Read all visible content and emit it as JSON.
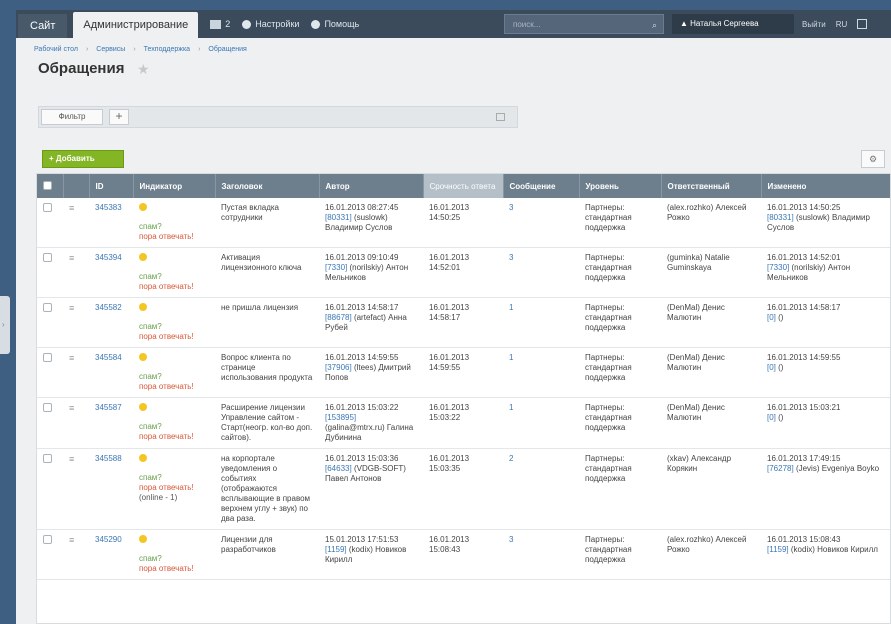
{
  "topbar": {
    "site_tab": "Сайт",
    "admin_tab": "Администрирование",
    "notifications_count": "2",
    "settings_label": "Настройки",
    "help_label": "Помощь",
    "search_placeholder": "поиск...",
    "user_name": "Наталья Сергеева",
    "logout_label": "Выйти",
    "lang_label": "RU"
  },
  "breadcrumb": [
    "Рабочий стол",
    "Сервисы",
    "Техподдержка",
    "Обращения"
  ],
  "page": {
    "title": "Обращения"
  },
  "filter": {
    "button_label": "Фильтр",
    "add_symbol": "+"
  },
  "toolbar": {
    "add_label": "Добавить"
  },
  "table": {
    "columns": [
      "ID",
      "Индикатор",
      "Заголовок",
      "Автор",
      "Срочность ответа",
      "Сообщение",
      "Уровень",
      "Ответственный",
      "Изменено"
    ],
    "spam_label": "спам?",
    "answer_label": "пора отвечать!",
    "rows": [
      {
        "id": "345383",
        "extra": "",
        "title": "Пустая вкладка сотрудники",
        "author_date": "16.01.2013 08:27:45",
        "author_link": "[80331]",
        "author_name": "(suslowk) Владимир Суслов",
        "urgency": "16.01.2013 14:50:25",
        "messages": "3",
        "level": "Партнеры: стандартная поддержка",
        "responsible": "(alex.rozhko) Алексей Рожко",
        "changed": "16.01.2013 14:50:25",
        "changed_link": "[80331]",
        "changed_name": "(suslowk) Владимир Суслов"
      },
      {
        "id": "345394",
        "extra": "",
        "title": "Активация лицензионного ключа",
        "author_date": "16.01.2013 09:10:49",
        "author_link": "[7330]",
        "author_name": "(norilskiy) Антон Мельников",
        "urgency": "16.01.2013 14:52:01",
        "messages": "3",
        "level": "Партнеры: стандартная поддержка",
        "responsible": "(guminka) Natalie Guminskaya",
        "changed": "16.01.2013 14:52:01",
        "changed_link": "[7330]",
        "changed_name": "(norilskiy) Антон Мельников"
      },
      {
        "id": "345582",
        "extra": "",
        "title": "не пришла лицензия",
        "author_date": "16.01.2013 14:58:17",
        "author_link": "[88678]",
        "author_name": "(artefact) Анна Рубей",
        "urgency": "16.01.2013 14:58:17",
        "messages": "1",
        "level": "Партнеры: стандартная поддержка",
        "responsible": "(DenMal) Денис Малютин",
        "changed": "16.01.2013 14:58:17",
        "changed_link": "[0]",
        "changed_name": "()"
      },
      {
        "id": "345584",
        "extra": "",
        "title": "Вопрос клиента по странице использования продукта",
        "author_date": "16.01.2013 14:59:55",
        "author_link": "[37906]",
        "author_name": "(ltees) Дмитрий Попов",
        "urgency": "16.01.2013 14:59:55",
        "messages": "1",
        "level": "Партнеры: стандартная поддержка",
        "responsible": "(DenMal) Денис Малютин",
        "changed": "16.01.2013 14:59:55",
        "changed_link": "[0]",
        "changed_name": "()"
      },
      {
        "id": "345587",
        "extra": "",
        "title": "Расширение лицензии Управление сайтом - Старт(неогр. кол-во доп. сайтов).",
        "author_date": "16.01.2013 15:03:22",
        "author_link": "[153895]",
        "author_name": "(galina@mtrx.ru) Галина Дубинина",
        "urgency": "16.01.2013 15:03:22",
        "messages": "1",
        "level": "Партнеры: стандартная поддержка",
        "responsible": "(DenMal) Денис Малютин",
        "changed": "16.01.2013 15:03:21",
        "changed_link": "[0]",
        "changed_name": "()"
      },
      {
        "id": "345588",
        "extra": "(online - 1)",
        "title": "на корпортале уведомления о событиях (отображаются всплывающие в правом верхнем углу + звук) по два раза.",
        "author_date": "16.01.2013 15:03:36",
        "author_link": "[64633]",
        "author_name": "(VDGB-SOFT) Павел Антонов",
        "urgency": "16.01.2013 15:03:35",
        "messages": "2",
        "level": "Партнеры: стандартная поддержка",
        "responsible": "(xkav) Александр Корякин",
        "changed": "16.01.2013 17:49:15",
        "changed_link": "[76278]",
        "changed_name": "(Jevis) Evgeniya Boyko"
      },
      {
        "id": "345290",
        "extra": "",
        "title": "Лицензии для разработчиков",
        "author_date": "15.01.2013 17:51:53",
        "author_link": "[1159]",
        "author_name": "(kodix) Новиков Кирилл",
        "urgency": "16.01.2013 15:08:43",
        "messages": "3",
        "level": "Партнеры: стандартная поддержка",
        "responsible": "(alex.rozhko) Алексей Рожко",
        "changed": "16.01.2013 15:08:43",
        "changed_link": "[1159]",
        "changed_name": "(kodix) Новиков Кирилл"
      }
    ]
  }
}
